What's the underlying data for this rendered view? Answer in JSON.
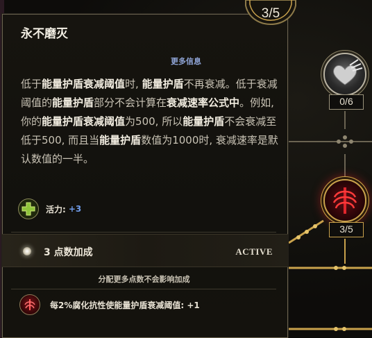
{
  "skill": {
    "title": "永不磨灭",
    "rank": "3/5",
    "more_info": "更多信息",
    "description": [
      {
        "text": "低于",
        "bold": false
      },
      {
        "text": "能量护盾衰减阈值",
        "bold": true
      },
      {
        "text": "时, ",
        "bold": false
      },
      {
        "text": "能量护盾",
        "bold": true
      },
      {
        "text": "不再衰减。低于衰减阈值的",
        "bold": false
      },
      {
        "text": "能量护盾",
        "bold": true
      },
      {
        "text": "部分不会计算在",
        "bold": false
      },
      {
        "text": "衰减速率公式中",
        "bold": true
      },
      {
        "text": "。例如, 你的",
        "bold": false
      },
      {
        "text": "能量护盾衰减阈值",
        "bold": true
      },
      {
        "text": "为500, 所以",
        "bold": false
      },
      {
        "text": "能量护盾",
        "bold": true
      },
      {
        "text": "不会衰减至低于500, 而且当",
        "bold": false
      },
      {
        "text": "能量护盾",
        "bold": true
      },
      {
        "text": "数值为1000时, 衰减速率是默认数值的一半。",
        "bold": false
      }
    ],
    "stat": {
      "icon": "vitality-cross-icon",
      "label": "活力:",
      "value": "+3"
    }
  },
  "bonus": {
    "title": "3 点数加成",
    "status": "ACTIVE",
    "note": "分配更多点数不会影响加成",
    "effect_label": "每2%腐化抗性使能量护盾衰减阈值:",
    "effect_value": "+1",
    "effect_icon": "corruption-spine-icon"
  },
  "board": {
    "heart_node": {
      "icon": "winged-heart-icon",
      "count": "0/6"
    },
    "spine_node": {
      "icon": "crimson-spine-icon",
      "count": "3/5"
    }
  },
  "colors": {
    "accent_blue": "#8fa4d6",
    "stat_blue": "#6f9be8",
    "gold": "#c9a24c",
    "panel_bg": "#14120d"
  }
}
